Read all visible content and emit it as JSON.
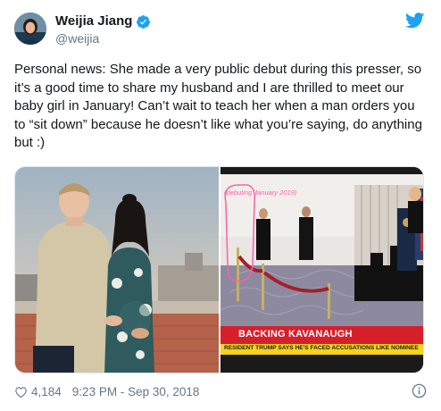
{
  "author": {
    "display_name": "Weijia Jiang",
    "handle": "@weijia",
    "verified": true,
    "avatar_icon": "avatar-photo"
  },
  "tweet": {
    "text": "Personal news: She made a very public debut during this presser, so it’s a good time to share my husband and I are thrilled to meet our baby girl in January! Can’t wait to teach her when a man orders you to “sit down” because he doesn’t like what you’re saying, do anything but :)"
  },
  "media": {
    "right_photo": {
      "overlay_label": "(debuting January 2019)",
      "banner_headline": "BACKING KAVANAUGH",
      "banner_ticker": "RESIDENT TRUMP SAYS HE'S FACED ACCUSATIONS LIKE NOMINEE"
    }
  },
  "footer": {
    "likes": "4,184",
    "timestamp": "9:23 PM - Sep 30, 2018",
    "heart_icon": "heart-icon",
    "info_icon": "info-icon"
  },
  "colors": {
    "twitter_blue": "#1da1f2",
    "text_primary": "#14171a",
    "text_secondary": "#657786",
    "banner_yellow": "#f7d21e",
    "banner_red": "#d71f2b"
  }
}
